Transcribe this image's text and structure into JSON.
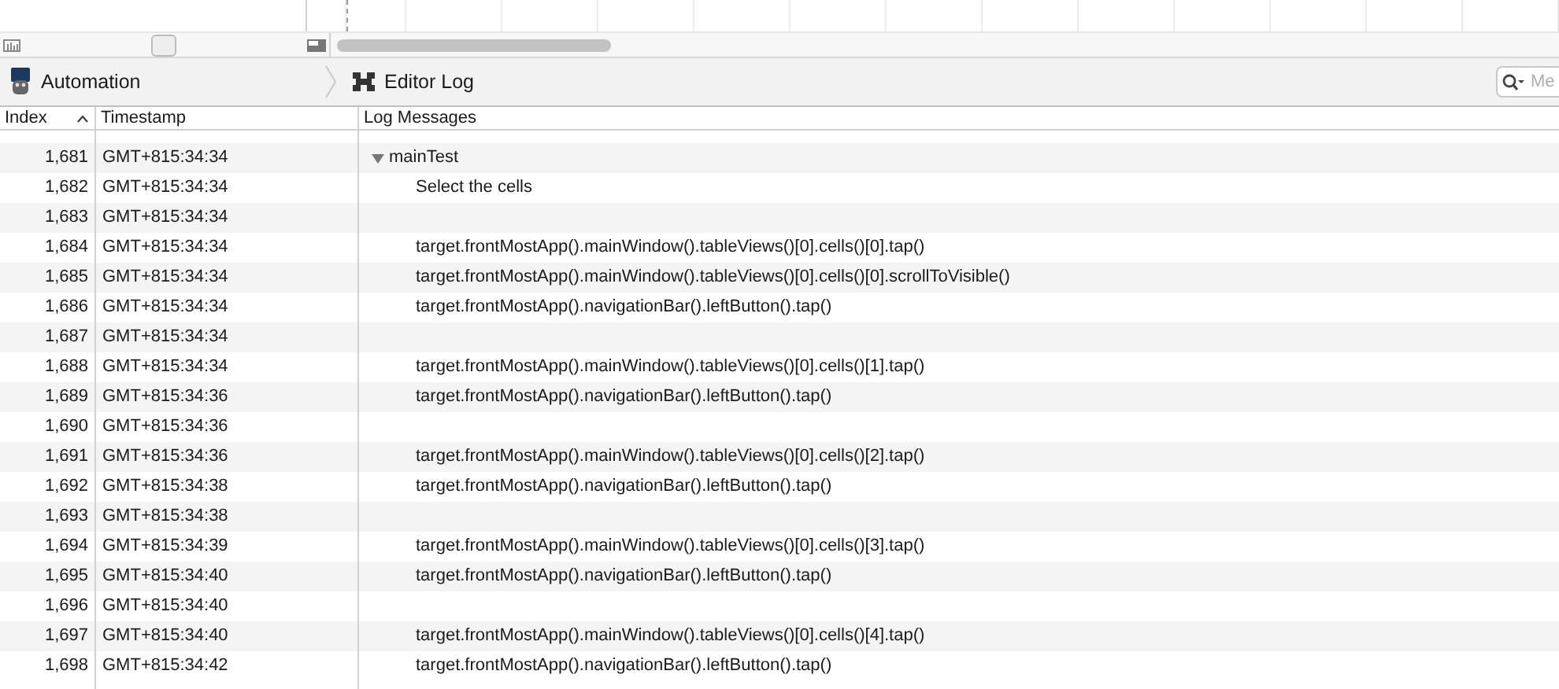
{
  "breadcrumb": [
    {
      "label": "Automation"
    },
    {
      "label": "Editor Log"
    }
  ],
  "search": {
    "placeholder": "Me"
  },
  "table": {
    "columns": [
      {
        "label": "Index",
        "sorted": true
      },
      {
        "label": "Timestamp",
        "sorted": false
      },
      {
        "label": "Log Messages",
        "sorted": false
      }
    ],
    "rows": [
      {
        "index": "1,681",
        "timestamp": "GMT+815:34:34",
        "message": "mainTest",
        "expanded": true,
        "children": [
          {
            "index": "1,682",
            "timestamp": "GMT+815:34:34",
            "message": "Select the cells"
          },
          {
            "index": "1,683",
            "timestamp": "GMT+815:34:34"
          },
          {
            "index": "1,684",
            "timestamp": "GMT+815:34:34",
            "message": "target.frontMostApp().mainWindow().tableViews()[0].cells()[0].tap()"
          },
          {
            "index": "1,685",
            "timestamp": "GMT+815:34:34",
            "message": "target.frontMostApp().mainWindow().tableViews()[0].cells()[0].scrollToVisible()"
          },
          {
            "index": "1,686",
            "timestamp": "GMT+815:34:34",
            "message": "target.frontMostApp().navigationBar().leftButton().tap()"
          },
          {
            "index": "1,687",
            "timestamp": "GMT+815:34:34"
          },
          {
            "index": "1,688",
            "timestamp": "GMT+815:34:34",
            "message": "target.frontMostApp().mainWindow().tableViews()[0].cells()[1].tap()"
          },
          {
            "index": "1,689",
            "timestamp": "GMT+815:34:36",
            "message": "target.frontMostApp().navigationBar().leftButton().tap()"
          },
          {
            "index": "1,690",
            "timestamp": "GMT+815:34:36"
          },
          {
            "index": "1,691",
            "timestamp": "GMT+815:34:36",
            "message": "target.frontMostApp().mainWindow().tableViews()[0].cells()[2].tap()"
          },
          {
            "index": "1,692",
            "timestamp": "GMT+815:34:38",
            "message": "target.frontMostApp().navigationBar().leftButton().tap()"
          },
          {
            "index": "1,693",
            "timestamp": "GMT+815:34:38"
          },
          {
            "index": "1,694",
            "timestamp": "GMT+815:34:39",
            "message": "target.frontMostApp().mainWindow().tableViews()[0].cells()[3].tap()"
          },
          {
            "index": "1,695",
            "timestamp": "GMT+815:34:40",
            "message": "target.frontMostApp().navigationBar().leftButton().tap()"
          },
          {
            "index": "1,696",
            "timestamp": "GMT+815:34:40"
          },
          {
            "index": "1,697",
            "timestamp": "GMT+815:34:40",
            "message": "target.frontMostApp().mainWindow().tableViews()[0].cells()[4].tap()"
          },
          {
            "index": "1,698",
            "timestamp": "GMT+815:34:42",
            "message": "target.frontMostApp().navigationBar().leftButton().tap()"
          }
        ]
      }
    ]
  }
}
